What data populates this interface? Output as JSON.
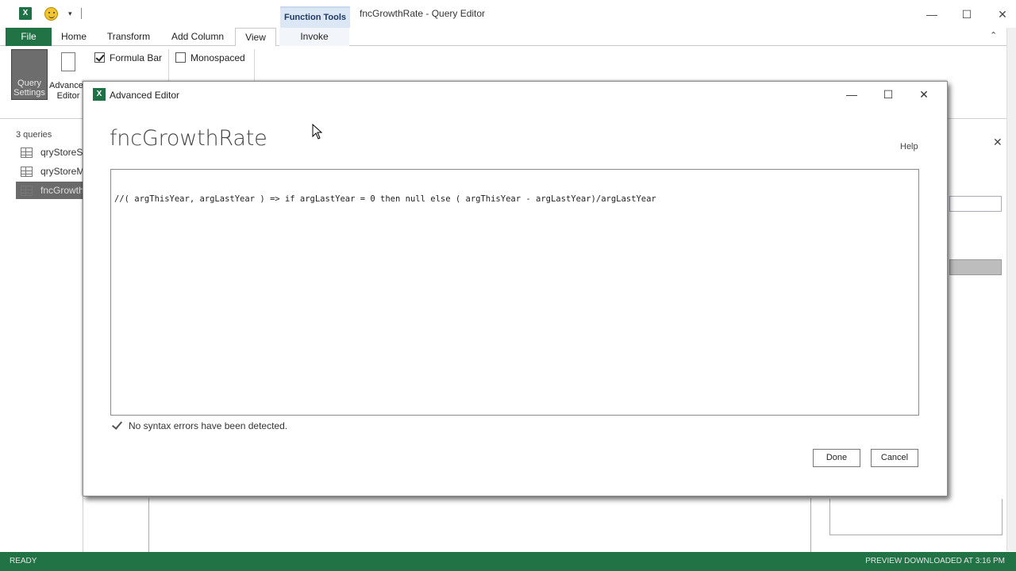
{
  "window": {
    "title": "fncGrowthRate - Query Editor",
    "contextual_group": "Function Tools",
    "minimize_glyph": "—",
    "maximize_glyph": "☐",
    "close_glyph": "✕"
  },
  "qat": {
    "app_icon_letter": "X",
    "dropdown_glyph": "▾"
  },
  "ribbon": {
    "tabs": [
      {
        "label": "File"
      },
      {
        "label": "Home"
      },
      {
        "label": "Transform"
      },
      {
        "label": "Add Column"
      },
      {
        "label": "View",
        "selected": true
      },
      {
        "label": "Invoke"
      }
    ],
    "collapse_glyph": "⌃",
    "query_settings_label": "Query Settings",
    "advanced_editor_label": "Advanced Editor",
    "formula_bar": {
      "label": "Formula Bar",
      "checked": true
    },
    "monospaced": {
      "label": "Monospaced",
      "checked": false
    }
  },
  "queries_pane": {
    "count_label": "3 queries",
    "items": [
      {
        "label": "qryStoreSales"
      },
      {
        "label": "qryStoreM..."
      },
      {
        "label": "fncGrowth..."
      }
    ]
  },
  "right_pane": {
    "close_glyph": "✕"
  },
  "status_bar": {
    "left": "READY",
    "right": "PREVIEW DOWNLOADED AT 3:16 PM"
  },
  "dialog": {
    "app_icon_letter": "X",
    "title": "Advanced Editor",
    "heading": "fncGrowthRate",
    "help_label": "Help",
    "code": "//( argThisYear, argLastYear ) => if argLastYear = 0 then null else ( argThisYear - argLastYear)/argLastYear",
    "syntax_status": "No syntax errors have been detected.",
    "done_label": "Done",
    "cancel_label": "Cancel",
    "minimize_glyph": "—",
    "maximize_glyph": "☐",
    "close_glyph": "✕"
  },
  "colors": {
    "excel_green": "#217346",
    "contextual_tab": "#dbe7f5"
  }
}
